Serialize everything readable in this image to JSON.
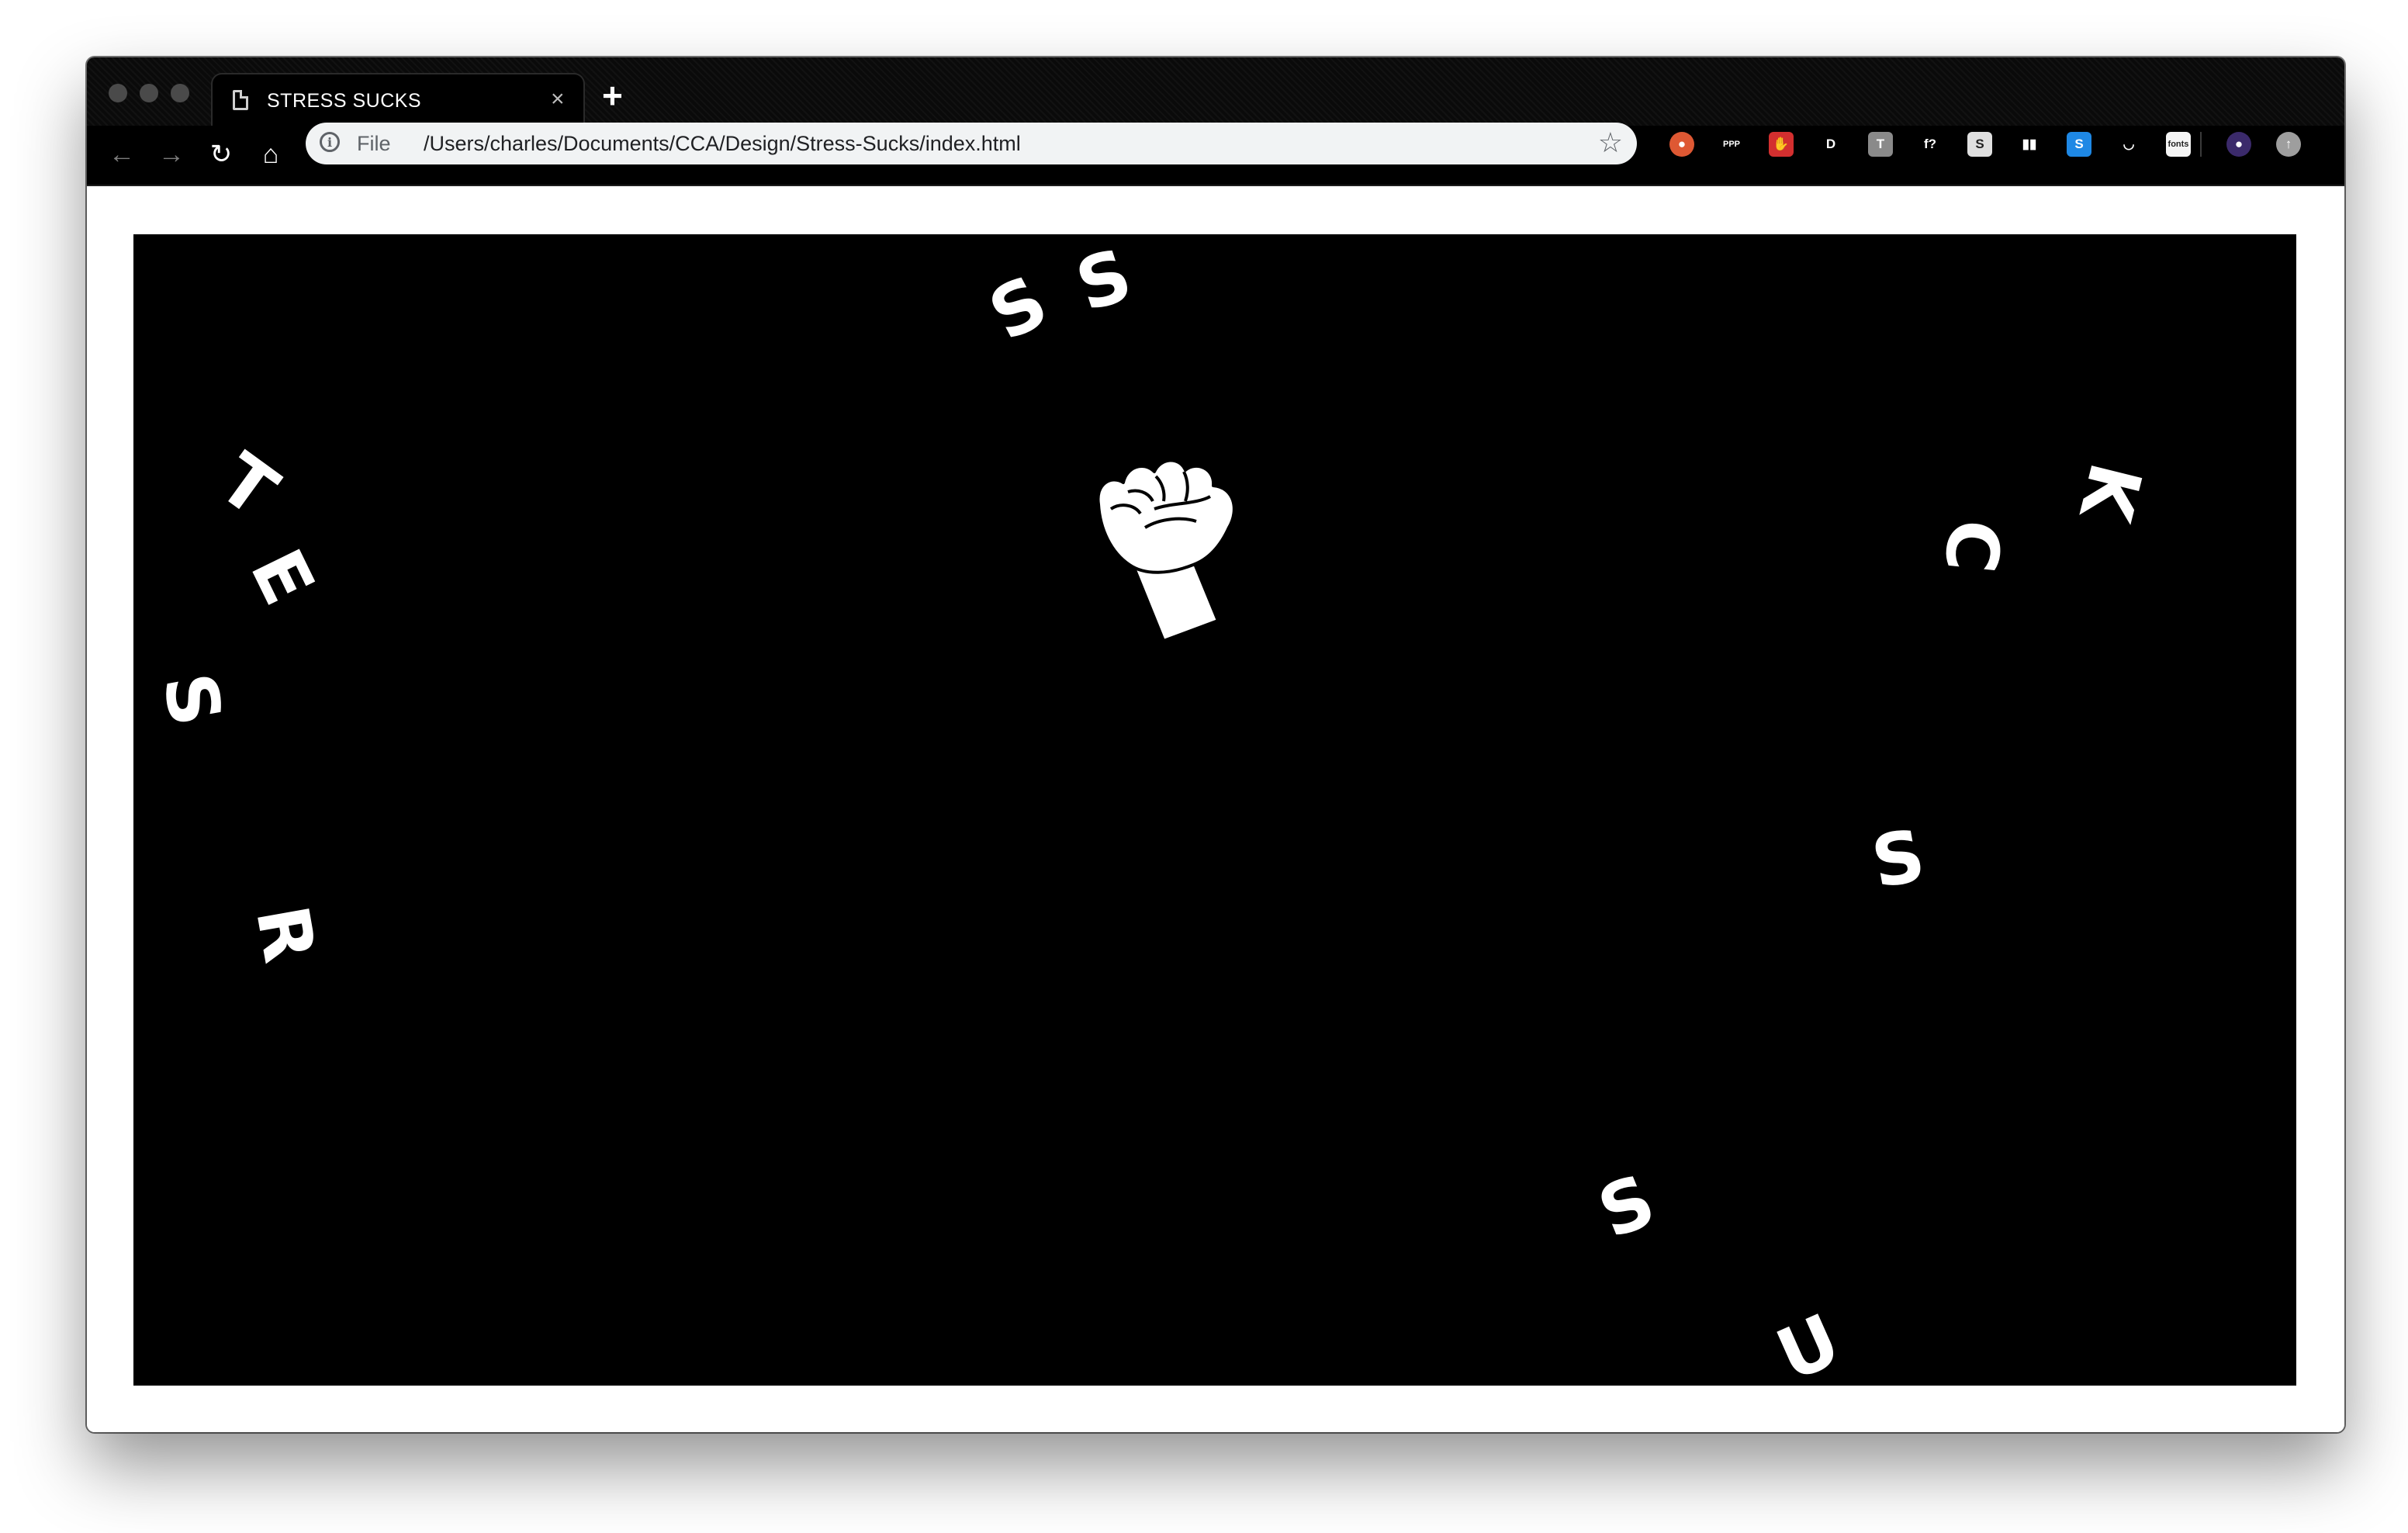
{
  "browser": {
    "tab": {
      "title": "STRESS SUCKS",
      "close_glyph": "×",
      "icon": "page-icon"
    },
    "new_tab_glyph": "+",
    "nav": {
      "back_glyph": "←",
      "forward_glyph": "→",
      "reload_glyph": "↻",
      "home_glyph": "⌂"
    },
    "omnibox": {
      "info_glyph": "i",
      "scheme": "File",
      "url": "/Users/charles/Documents/CCA/Design/Stress-Sucks/index.html",
      "star_glyph": "☆"
    },
    "extensions": [
      {
        "name": "duckduckgo-icon",
        "glyph": "●",
        "color": "#de5833"
      },
      {
        "name": "ppp-icon",
        "glyph": "PPP",
        "color": "#000000"
      },
      {
        "name": "stop-hand-icon",
        "glyph": "✋",
        "color": "#d32f2f"
      },
      {
        "name": "dl-icon",
        "glyph": "D",
        "color": "#000000"
      },
      {
        "name": "t-icon",
        "glyph": "T",
        "color": "#8a8a8a"
      },
      {
        "name": "whatfont-icon",
        "glyph": "f?",
        "color": "#000000"
      },
      {
        "name": "s-icon",
        "glyph": "S",
        "color": "#e0e0e0"
      },
      {
        "name": "columns-icon",
        "glyph": "▮▮",
        "color": "#000000"
      },
      {
        "name": "skype-s-icon",
        "glyph": "S",
        "color": "#1e88e5"
      },
      {
        "name": "lips-icon",
        "glyph": "◡",
        "color": "#000000"
      },
      {
        "name": "fonts-icon",
        "glyph": "fonts",
        "color": "#f5f5f5"
      },
      {
        "name": "avatar-icon",
        "glyph": "●",
        "color": "#3b2a6b"
      },
      {
        "name": "update-icon",
        "glyph": "↑",
        "color": "#9e9e9e"
      }
    ]
  },
  "page": {
    "background": "#000000",
    "letters": [
      {
        "char": "S",
        "name": "letter-s-top-1"
      },
      {
        "char": "S",
        "name": "letter-s-top-2"
      },
      {
        "char": "T",
        "name": "letter-t"
      },
      {
        "char": "E",
        "name": "letter-e"
      },
      {
        "char": "S",
        "name": "letter-s-left"
      },
      {
        "char": "R",
        "name": "letter-r"
      },
      {
        "char": "K",
        "name": "letter-k"
      },
      {
        "char": "C",
        "name": "letter-c"
      },
      {
        "char": "S",
        "name": "letter-s-right"
      },
      {
        "char": "S",
        "name": "letter-s-bottom"
      },
      {
        "char": "U",
        "name": "letter-u"
      }
    ],
    "fist_icon": "raised-fist-icon"
  }
}
